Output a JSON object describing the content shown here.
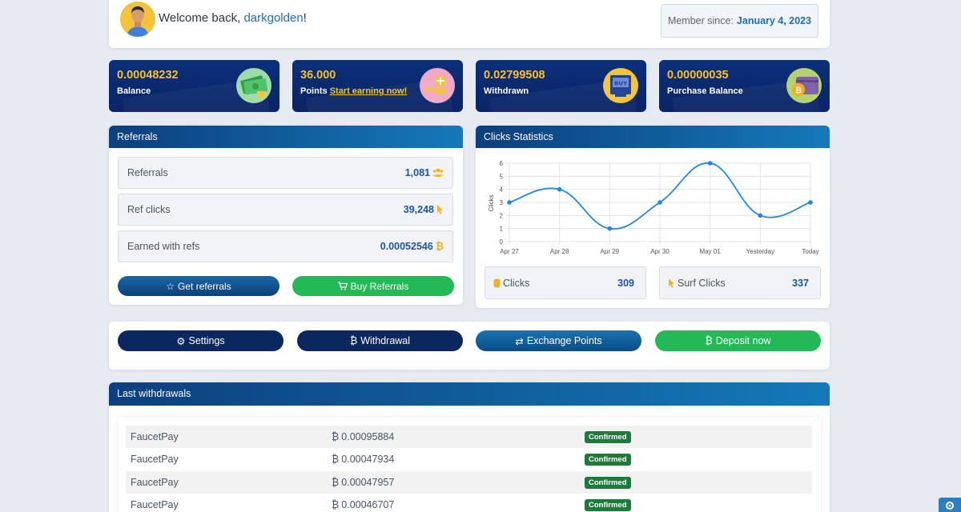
{
  "welcome": {
    "prefix": "Welcome back, ",
    "username": "darkgolden",
    "suffix": "!"
  },
  "member": {
    "label": "Member since:",
    "date": "January 4, 2023"
  },
  "stats": [
    {
      "value": "0.00048232",
      "label": "Balance",
      "icon": "money-icon"
    },
    {
      "value": "36.000",
      "label": "Points",
      "link": "Start earning now!",
      "icon": "coins-hand-icon"
    },
    {
      "value": "0.02799508",
      "label": "Withdrawn",
      "icon": "buy-screen-icon"
    },
    {
      "value": "0.00000035",
      "label": "Purchase Balance",
      "icon": "wallet-coin-icon"
    }
  ],
  "referrals": {
    "title": "Referrals",
    "rows": [
      {
        "label": "Referrals",
        "value": "1,081",
        "icon": "users-icon"
      },
      {
        "label": "Ref clicks",
        "value": "39,248",
        "icon": "cursor-icon"
      },
      {
        "label": "Earned with refs",
        "value": "0.00052546",
        "icon": "bitcoin-icon"
      }
    ],
    "get_btn": "Get referrals",
    "buy_btn": "Buy Referrals"
  },
  "clicks": {
    "title": "Clicks Statistics",
    "clicks_label": "Clicks",
    "clicks_value": "309",
    "surf_label": "Surf Clicks",
    "surf_value": "337"
  },
  "chart_data": {
    "type": "line",
    "categories": [
      "Apr 27",
      "Apr 28",
      "Apr 29",
      "Apr 30",
      "May 01",
      "Yesterday",
      "Today"
    ],
    "values": [
      3,
      4,
      1,
      3,
      6,
      2,
      3
    ],
    "ylabel": "Clicks",
    "ylim": [
      0,
      6
    ],
    "yticks": [
      0,
      1,
      2,
      3,
      4,
      5,
      6
    ],
    "grid": true,
    "color": "#1e88e5"
  },
  "actions": {
    "settings": "Settings",
    "withdrawal": "Withdrawal",
    "exchange": "Exchange Points",
    "deposit": "Deposit now"
  },
  "withdrawals": {
    "title": "Last withdrawals",
    "rows": [
      {
        "method": "FaucetPay",
        "amount": "0.00095884",
        "status": "Confirmed"
      },
      {
        "method": "FaucetPay",
        "amount": "0.00047934",
        "status": "Confirmed"
      },
      {
        "method": "FaucetPay",
        "amount": "0.00047957",
        "status": "Confirmed"
      },
      {
        "method": "FaucetPay",
        "amount": "0.00046707",
        "status": "Confirmed"
      }
    ]
  }
}
